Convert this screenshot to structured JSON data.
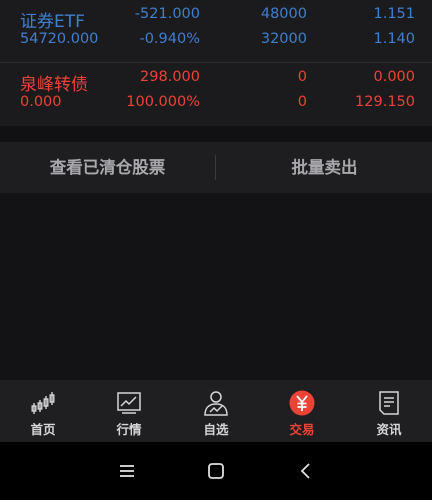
{
  "holdings": [
    {
      "name": "证券ETF",
      "row1": [
        "-521.000",
        "48000",
        "1.151"
      ],
      "row2": [
        "54720.000",
        "-0.940%",
        "32000",
        "1.140"
      ],
      "color": "#3f7fcf"
    },
    {
      "name": "泉峰转债",
      "row1": [
        "298.000",
        "0",
        "0.000"
      ],
      "row2": [
        "0.000",
        "100.000%",
        "0",
        "129.150"
      ],
      "color": "#ee4236"
    }
  ],
  "actions": {
    "view_cleared": "查看已清仓股票",
    "batch_sell": "批量卖出"
  },
  "tabs": [
    {
      "label": "首页",
      "icon": "candlestick-icon"
    },
    {
      "label": "行情",
      "icon": "line-chart-icon"
    },
    {
      "label": "自选",
      "icon": "person-chart-icon"
    },
    {
      "label": "交易",
      "icon": "yen-icon",
      "active": true
    },
    {
      "label": "资讯",
      "icon": "document-icon"
    }
  ],
  "colors": {
    "up_red": "#ee4236",
    "down_blue": "#3f7fcf",
    "background": "#111113",
    "panel": "#1b1b1d"
  }
}
